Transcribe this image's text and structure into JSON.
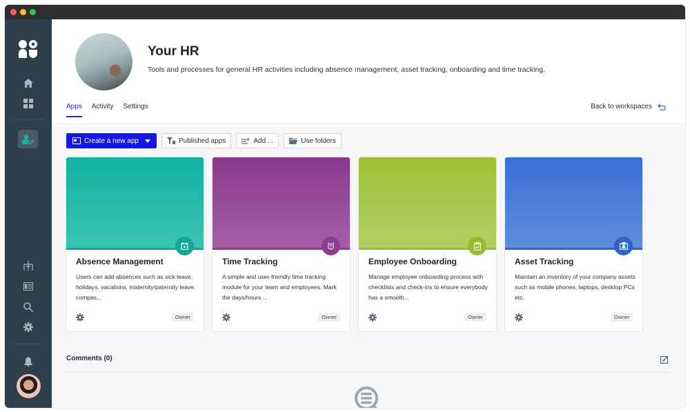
{
  "window": {
    "controls": [
      "close",
      "minimize",
      "maximize"
    ]
  },
  "sidebar": {
    "logo": "app-logo-icon",
    "top_items": [
      {
        "name": "home",
        "icon": "home-icon"
      },
      {
        "name": "dashboard",
        "icon": "grid-icon"
      }
    ],
    "active_item": {
      "name": "hr-workspace",
      "icon": "user-edit-icon"
    },
    "bottom_items": [
      {
        "name": "org-chart",
        "icon": "hierarchy-icon"
      },
      {
        "name": "tables",
        "icon": "table-icon"
      },
      {
        "name": "search",
        "icon": "search-icon"
      },
      {
        "name": "settings",
        "icon": "gear-icon"
      },
      {
        "name": "notifications",
        "icon": "bell-icon"
      }
    ],
    "user_avatar": "user-avatar"
  },
  "header": {
    "title": "Your HR",
    "description": "Tools and processes for general HR activities including absence management, asset tracking, onboarding and time tracking.",
    "tabs": [
      {
        "label": "Apps",
        "active": true
      },
      {
        "label": "Activity",
        "active": false
      },
      {
        "label": "Settings",
        "active": false
      }
    ],
    "back_link": "Back to workspaces"
  },
  "toolbar": {
    "create_label": "Create a new app",
    "published_label": "Published apps",
    "add_label": "Add ...",
    "folders_label": "Use folders"
  },
  "apps": [
    {
      "title": "Absence Management",
      "description": "Users can add absences such as sick leave, holidays, vacations, maternity/paternity leave, compas...",
      "role": "Owner",
      "icon": "calendar-icon",
      "color_top": "#12b2a0",
      "color_bottom": "#3cc3b2",
      "accent": "#13a896"
    },
    {
      "title": "Time Tracking",
      "description": "A simple and user-friendly time tracking module for your team and employees. Mark the days/hours ...",
      "role": "Owner",
      "icon": "alarm-clock-icon",
      "color_top": "#8a3a8c",
      "color_bottom": "#a45fa6",
      "accent": "#8e3d90"
    },
    {
      "title": "Employee Onboarding",
      "description": "Manage employee onboarding process with checklists and check-ins to ensure everybody has a smooth...",
      "role": "Owner",
      "icon": "clipboard-check-icon",
      "color_top": "#9cc134",
      "color_bottom": "#b1d066",
      "accent": "#98bd2c"
    },
    {
      "title": "Asset Tracking",
      "description": "Maintain an inventory of your company assets such as mobile phones, laptops, desktop PCs etc.",
      "role": "Owner",
      "icon": "id-badge-icon",
      "color_top": "#3a6fd4",
      "color_bottom": "#5f8ddc",
      "accent": "#2f62cc"
    }
  ],
  "comments": {
    "title": "Comments (0)",
    "empty_icon": "comment-search-icon"
  }
}
